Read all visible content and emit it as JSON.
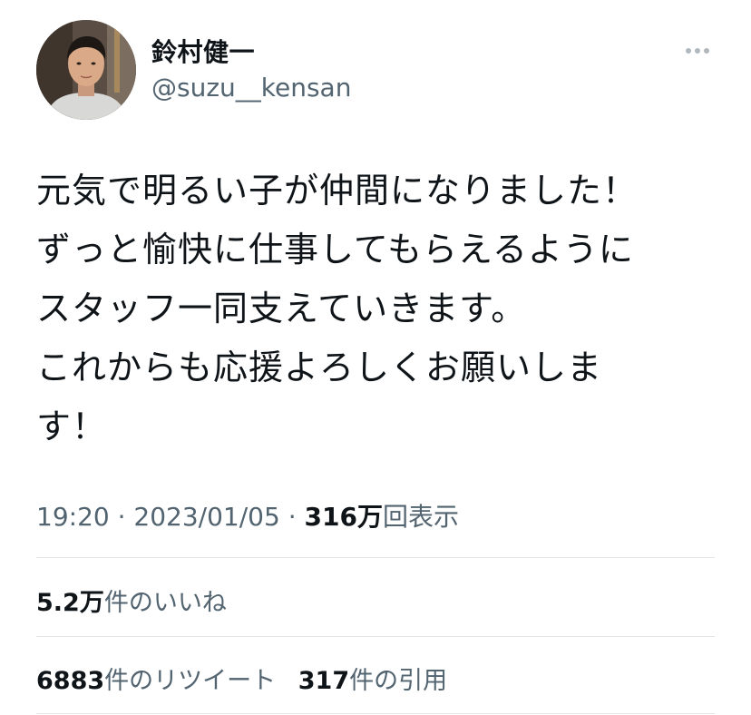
{
  "author": {
    "display_name": "鈴村健一",
    "username": "@suzu__kensan",
    "avatar_icon": "avatar-photo"
  },
  "more_icon": "more-horizontal-icon",
  "tweet": {
    "lines": [
      "元気で明るい子が仲間になりました！",
      "ずっと愉快に仕事してもらえるように",
      "スタッフ一同支えていきます。",
      "これからも応援よろしくお願いしま",
      "す！"
    ]
  },
  "meta": {
    "time": "19:20",
    "separator": "·",
    "date": "2023/01/05",
    "views_count": "316万",
    "views_label": "回表示"
  },
  "stats": {
    "likes_count": "5.2万",
    "likes_label": "件のいいね",
    "retweets_count": "6883",
    "retweets_label": "件のリツイート",
    "quotes_count": "317",
    "quotes_label": "件の引用"
  },
  "colors": {
    "text": "#0f1419",
    "secondary": "#536471",
    "divider": "#e3e6e9"
  }
}
